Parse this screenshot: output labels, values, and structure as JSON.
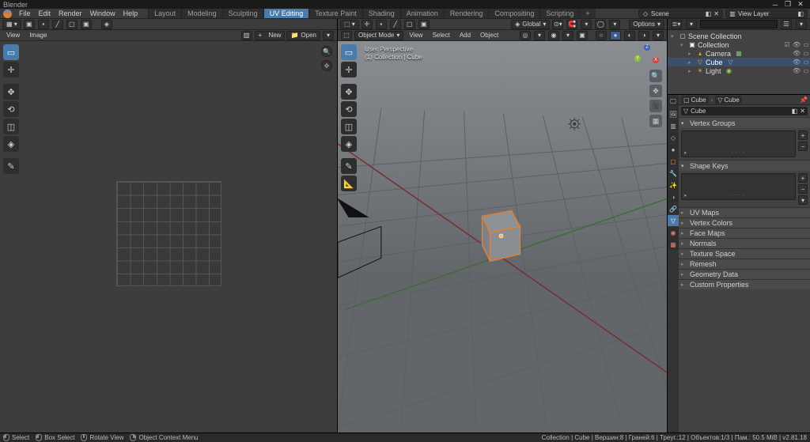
{
  "app_title": "Blender",
  "menu": {
    "file": "File",
    "edit": "Edit",
    "render": "Render",
    "window": "Window",
    "help": "Help"
  },
  "workspaces": [
    "Layout",
    "Modeling",
    "Sculpting",
    "UV Editing",
    "Texture Paint",
    "Shading",
    "Animation",
    "Rendering",
    "Compositing",
    "Scripting"
  ],
  "active_workspace": "UV Editing",
  "top_right": {
    "scene_label": "Scene",
    "viewlayer_label": "View Layer"
  },
  "uv_editor": {
    "menus": {
      "view": "View",
      "image": "Image"
    },
    "header_right": {
      "new": "New",
      "open": "Open",
      "plus": "+"
    }
  },
  "view3d": {
    "mode": "Object Mode",
    "menus": {
      "view": "View",
      "select": "Select",
      "add": "Add",
      "object": "Object"
    },
    "transform_orient": "Global",
    "options_label": "Options",
    "overlay": {
      "line1": "User Perspective",
      "line2": "(1) Collection | Cube"
    },
    "axes": {
      "x": "X",
      "y": "Y",
      "z": "Z"
    }
  },
  "outliner": {
    "root": "Scene Collection",
    "collection": "Collection",
    "items": [
      {
        "name": "Camera",
        "icon": "camera"
      },
      {
        "name": "Cube",
        "icon": "mesh",
        "selected": true
      },
      {
        "name": "Light",
        "icon": "light"
      }
    ]
  },
  "properties": {
    "breadcrumb": {
      "obj": "Cube",
      "data": "Cube"
    },
    "name_field": "Cube",
    "panels": {
      "vertex_groups": "Vertex Groups",
      "shape_keys": "Shape Keys",
      "uv_maps": "UV Maps",
      "vertex_colors": "Vertex Colors",
      "face_maps": "Face Maps",
      "normals": "Normals",
      "texture_space": "Texture Space",
      "remesh": "Remesh",
      "geometry_data": "Geometry Data",
      "custom_properties": "Custom Properties"
    }
  },
  "status": {
    "select": "Select",
    "box_select": "Box Select",
    "rotate_view": "Rotate View",
    "context_menu": "Object Context Menu",
    "right": "Collection | Cube | Вершин:8 | Граней:6 | Треуг.:12 | Объектов:1/3 | Пам.: 50.5 MiB | v2.81.18"
  }
}
